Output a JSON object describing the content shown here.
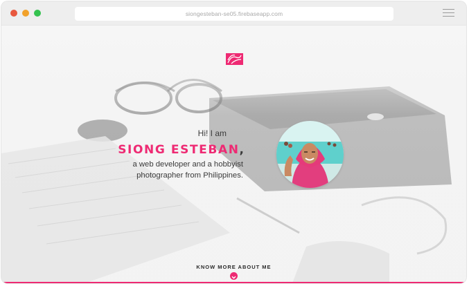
{
  "browser": {
    "url": "siongesteban-se05.firebaseapp.com"
  },
  "hero": {
    "greeting": "Hi! I am",
    "name": "SIONG ESTEBAN",
    "name_suffix": ",",
    "bio_line1": "a web developer and a hobbyist",
    "bio_line2": "photographer from Philippines.",
    "cta": "KNOW MORE ABOUT ME"
  },
  "colors": {
    "accent": "#ee2a73",
    "text": "#3a3a3a"
  },
  "icons": [
    "logo-icon",
    "menu-icon",
    "chevron-down-icon",
    "avatar"
  ]
}
